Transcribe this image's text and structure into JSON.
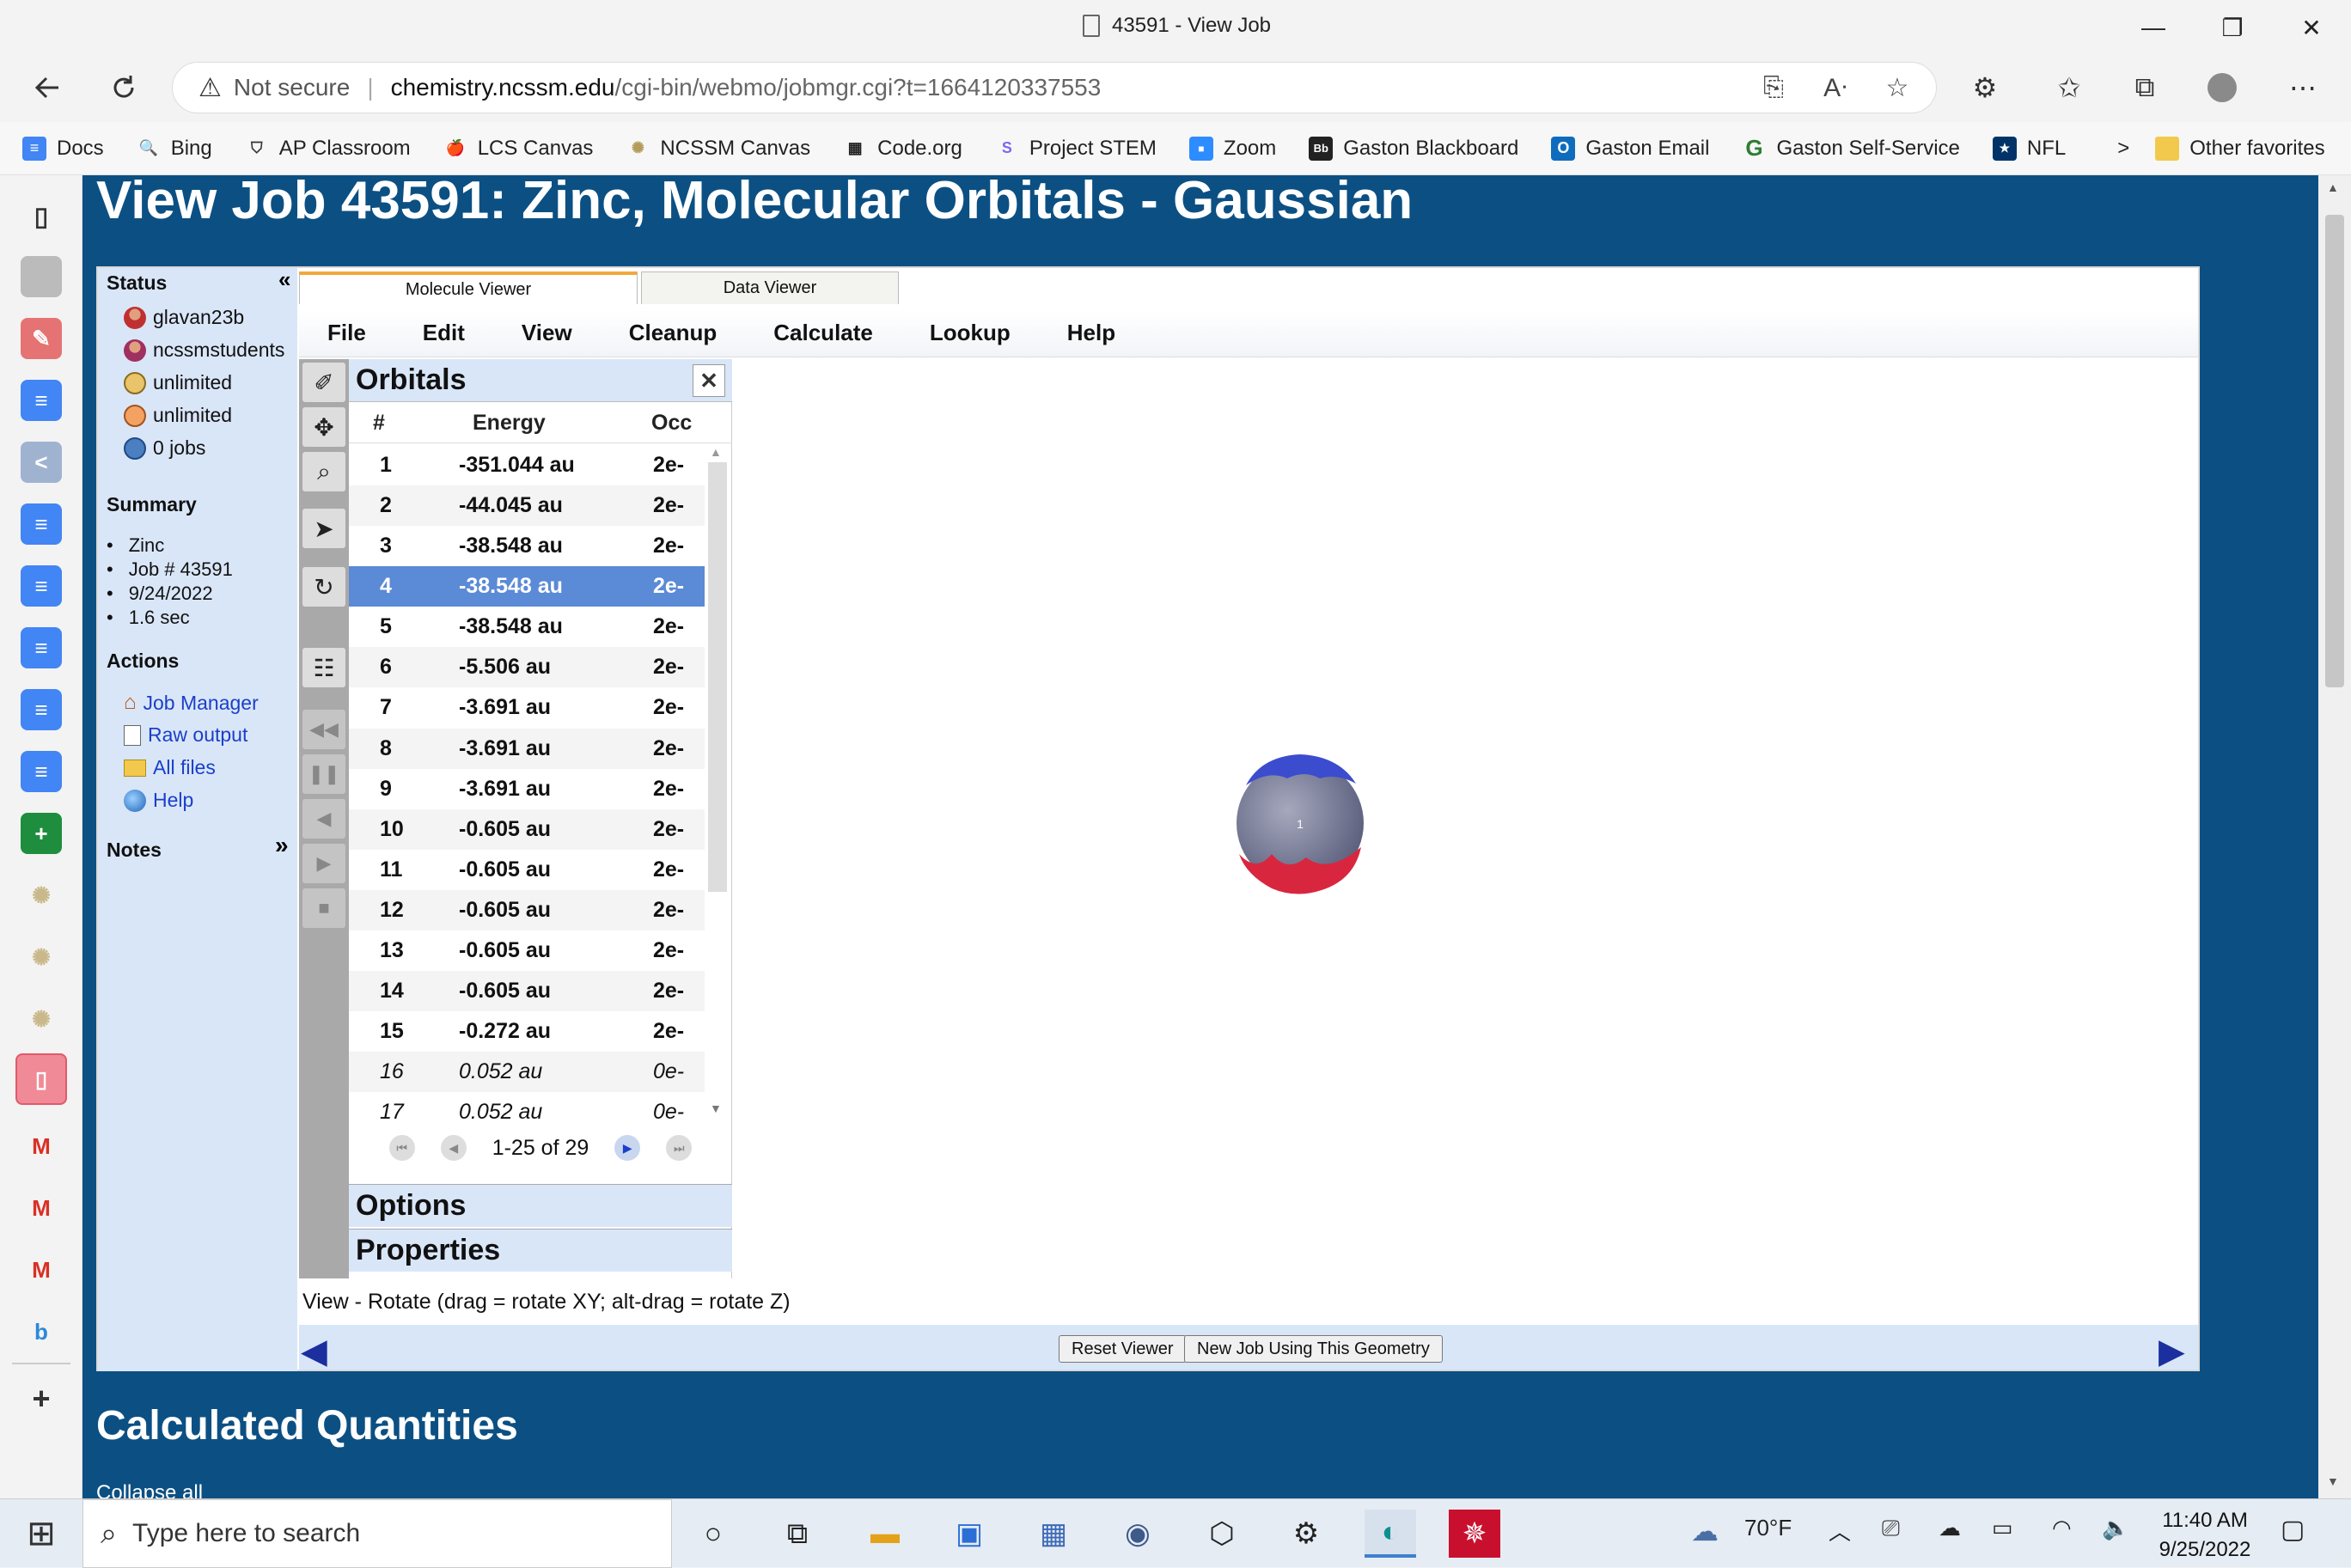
{
  "window": {
    "title": "43591 - View Job",
    "minimize": "—",
    "restore": "❐",
    "close": "✕"
  },
  "address": {
    "security": "Not secure",
    "host": "chemistry.ncssm.edu",
    "path": "/cgi-bin/webmo/jobmgr.cgi?t=1664120337553"
  },
  "favorites": [
    {
      "label": "Docs",
      "color": "#4285f4",
      "glyph": "≡"
    },
    {
      "label": "Bing",
      "color": "#2b579a",
      "glyph": "🔍"
    },
    {
      "label": "AP Classroom",
      "color": "#333333",
      "glyph": "⛉"
    },
    {
      "label": "LCS Canvas",
      "color": "#d32f2f",
      "glyph": "🍎"
    },
    {
      "label": "NCSSM Canvas",
      "color": "#b39b5a",
      "glyph": "✺"
    },
    {
      "label": "Code.org",
      "color": "#222222",
      "glyph": "▦"
    },
    {
      "label": "Project STEM",
      "color": "#7b68ee",
      "glyph": "S"
    },
    {
      "label": "Zoom",
      "color": "#2d8cff",
      "glyph": "■"
    },
    {
      "label": "Gaston Blackboard",
      "color": "#222222",
      "glyph": "Bb"
    },
    {
      "label": "Gaston Email",
      "color": "#0f6cbd",
      "glyph": "O"
    },
    {
      "label": "Gaston Self-Service",
      "color": "#2e7d32",
      "glyph": "G"
    },
    {
      "label": "NFL",
      "color": "#013369",
      "glyph": "★"
    }
  ],
  "favorites_more": ">",
  "other_favorites": "Other favorites",
  "page": {
    "title": "View Job 43591: Zinc, Molecular Orbitals - Gaussian",
    "section2": "Calculated Quantities",
    "collapse": "Collapse all"
  },
  "status_panel": {
    "status_heading": "Status",
    "user": "glavan23b",
    "group": "ncssmstudents",
    "limit1": "unlimited",
    "limit2": "unlimited",
    "jobs": "0 jobs",
    "summary_heading": "Summary",
    "summary_items": [
      "Zinc",
      "Job # 43591",
      "9/24/2022",
      "1.6 sec"
    ],
    "actions_heading": "Actions",
    "actions": [
      "Job Manager",
      "Raw output",
      "All files",
      "Help"
    ],
    "notes_heading": "Notes",
    "collapse_left": "«",
    "expand_right": "»"
  },
  "tabs": [
    "Molecule Viewer",
    "Data Viewer"
  ],
  "menu": [
    "File",
    "Edit",
    "View",
    "Cleanup",
    "Calculate",
    "Lookup",
    "Help"
  ],
  "orbitals": {
    "heading": "Orbitals",
    "close": "✕",
    "columns": [
      "#",
      "Energy",
      "Occ"
    ],
    "rows": [
      {
        "n": "1",
        "energy": "-351.044 au",
        "occ": "2e-"
      },
      {
        "n": "2",
        "energy": "-44.045 au",
        "occ": "2e-"
      },
      {
        "n": "3",
        "energy": "-38.548 au",
        "occ": "2e-"
      },
      {
        "n": "4",
        "energy": "-38.548 au",
        "occ": "2e-"
      },
      {
        "n": "5",
        "energy": "-38.548 au",
        "occ": "2e-"
      },
      {
        "n": "6",
        "energy": "-5.506 au",
        "occ": "2e-"
      },
      {
        "n": "7",
        "energy": "-3.691 au",
        "occ": "2e-"
      },
      {
        "n": "8",
        "energy": "-3.691 au",
        "occ": "2e-"
      },
      {
        "n": "9",
        "energy": "-3.691 au",
        "occ": "2e-"
      },
      {
        "n": "10",
        "energy": "-0.605 au",
        "occ": "2e-"
      },
      {
        "n": "11",
        "energy": "-0.605 au",
        "occ": "2e-"
      },
      {
        "n": "12",
        "energy": "-0.605 au",
        "occ": "2e-"
      },
      {
        "n": "13",
        "energy": "-0.605 au",
        "occ": "2e-"
      },
      {
        "n": "14",
        "energy": "-0.605 au",
        "occ": "2e-"
      },
      {
        "n": "15",
        "energy": "-0.272 au",
        "occ": "2e-"
      },
      {
        "n": "16",
        "energy": "0.052 au",
        "occ": "0e-"
      },
      {
        "n": "17",
        "energy": "0.052 au",
        "occ": "0e-"
      }
    ],
    "selected_index": 3,
    "pager": "1-25 of 29",
    "options": "Options",
    "properties": "Properties"
  },
  "viewer": {
    "status_line": "View - Rotate (drag = rotate XY; alt-drag = rotate Z)",
    "atom_label": "1",
    "reset_button": "Reset Viewer",
    "new_job_button": "New Job Using This Geometry"
  },
  "taskbar": {
    "search_placeholder": "Type here to search",
    "weather": "70°F",
    "time": "11:40 AM",
    "date": "9/25/2022"
  }
}
